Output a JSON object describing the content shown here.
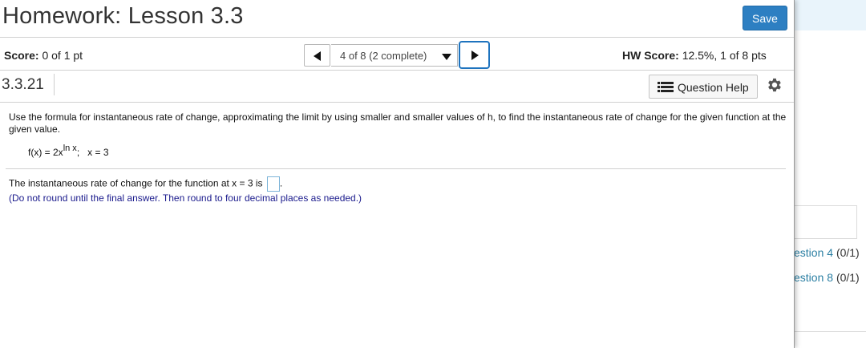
{
  "header": {
    "title": "Homework: Lesson 3.3",
    "save_label": "Save"
  },
  "score_bar": {
    "score_label": "Score:",
    "score_value": "0 of 1 pt",
    "question_selector": "4 of 8 (2 complete)",
    "hw_score_label": "HW Score:",
    "hw_score_value": "12.5%, 1 of 8 pts"
  },
  "question": {
    "number": "3.3.21",
    "help_label": "Question Help",
    "instructions": "Use the formula for instantaneous rate of change, approximating the limit by using smaller and smaller values of h, to find the instantaneous rate of change for the given function at the given value.",
    "formula_lhs": "f(x) = 2x",
    "formula_exponent": "ln x",
    "formula_sep": ";",
    "formula_point": "x = 3",
    "answer_prefix": "The instantaneous rate of change for the function at x = 3 is",
    "answer_value": "",
    "answer_suffix": ".",
    "hint": "(Do not round until the final answer. Then round to four decimal places as needed.)"
  },
  "side_panel": {
    "links": [
      {
        "label": "estion 4",
        "count": "(0/1)"
      },
      {
        "label": "estion 8",
        "count": "(0/1)"
      }
    ]
  },
  "colors": {
    "accent": "#2d7fc2",
    "focus_ring": "#1e73be",
    "hint_text": "#1a1a8c",
    "side_link": "#2b7fa3"
  },
  "icons": {
    "prev": "triangle-left-icon",
    "next": "triangle-right-icon",
    "dropdown": "caret-down-icon",
    "help": "list-icon",
    "settings": "gear-icon"
  }
}
